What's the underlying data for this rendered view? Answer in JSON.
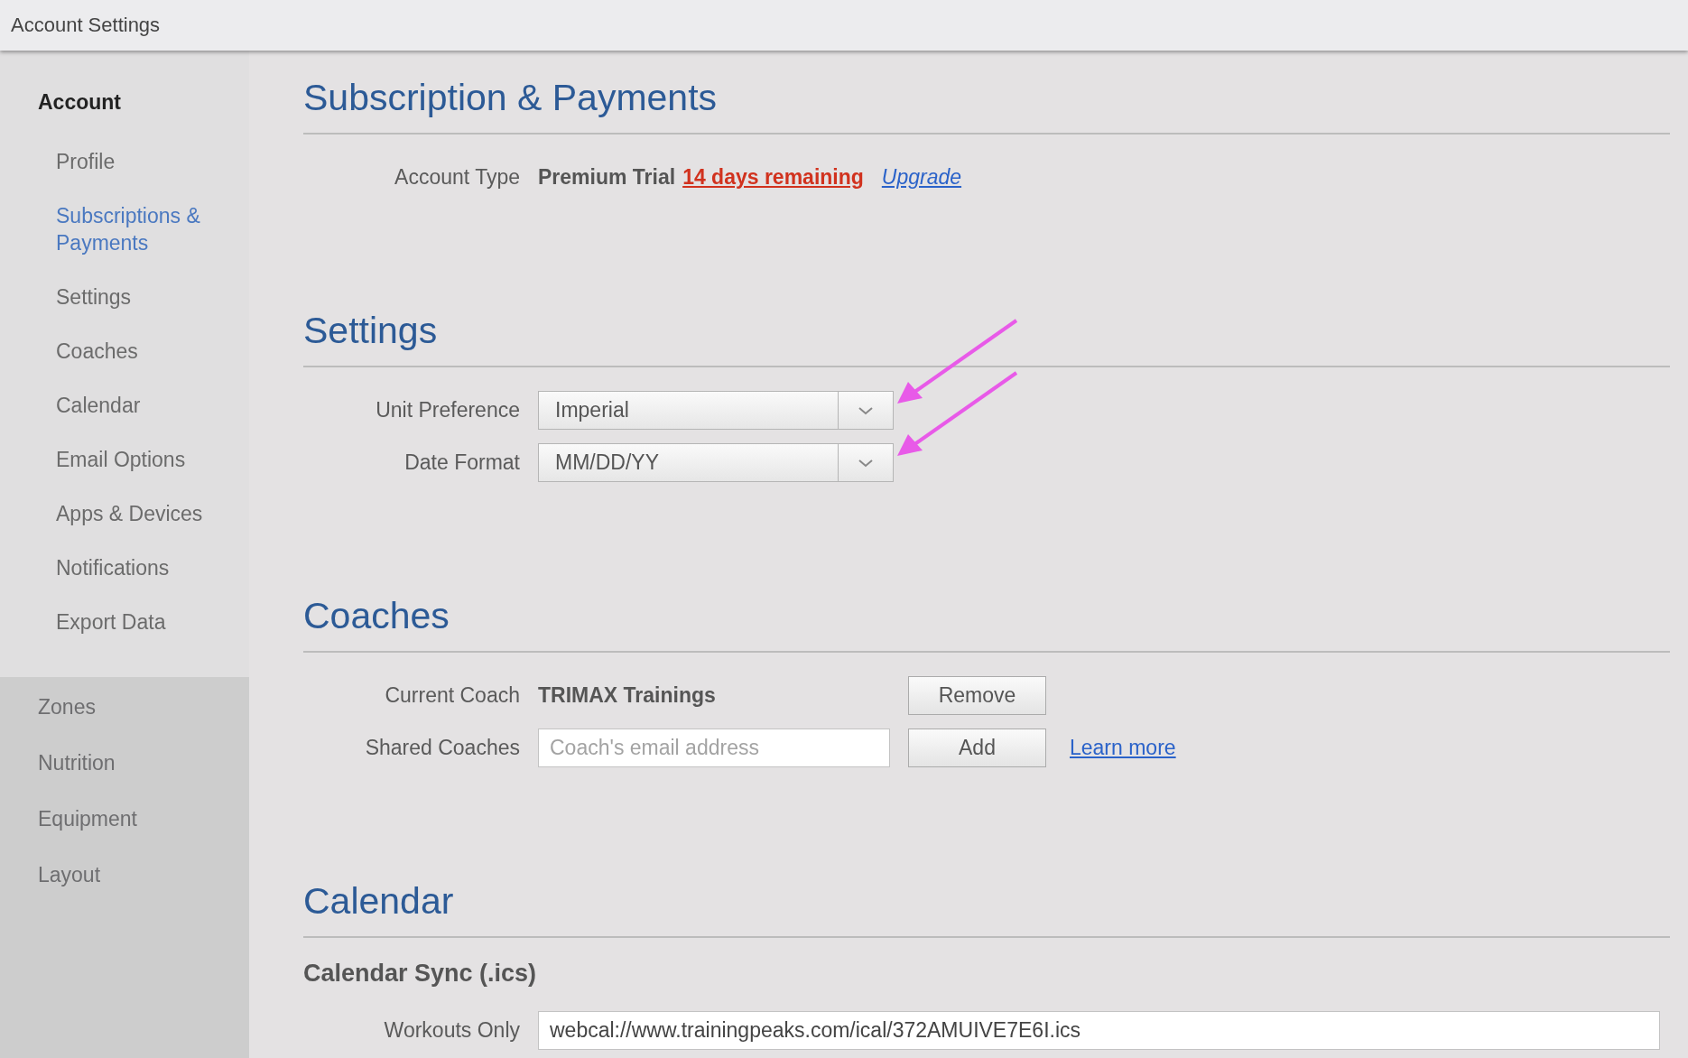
{
  "window": {
    "title": "Account Settings"
  },
  "sidebar": {
    "header": "Account",
    "items": [
      {
        "label": "Profile",
        "selected": false
      },
      {
        "label": "Subscriptions & Payments",
        "selected": true
      },
      {
        "label": "Settings",
        "selected": false
      },
      {
        "label": "Coaches",
        "selected": false
      },
      {
        "label": "Calendar",
        "selected": false
      },
      {
        "label": "Email Options",
        "selected": false
      },
      {
        "label": "Apps & Devices",
        "selected": false
      },
      {
        "label": "Notifications",
        "selected": false
      },
      {
        "label": "Export Data",
        "selected": false
      }
    ],
    "other_items": [
      {
        "label": "Zones"
      },
      {
        "label": "Nutrition"
      },
      {
        "label": "Equipment"
      },
      {
        "label": "Layout"
      }
    ]
  },
  "subscription": {
    "title": "Subscription & Payments",
    "label": "Account Type",
    "plan": "Premium Trial",
    "remaining": "14 days remaining",
    "upgrade_link": "Upgrade"
  },
  "settings": {
    "title": "Settings",
    "rows": [
      {
        "label": "Unit Preference",
        "value": "Imperial",
        "pointer_arrow": true
      },
      {
        "label": "Date Format",
        "value": "MM/DD/YY",
        "pointer_arrow": true
      }
    ]
  },
  "coaches": {
    "title": "Coaches",
    "current_label": "Current Coach",
    "current_coach": "TRIMAX Trainings",
    "remove_button": "Remove",
    "shared_label": "Shared Coaches",
    "email_placeholder": "Coach's email address",
    "add_button": "Add",
    "learn_more_link": "Learn more"
  },
  "calendar": {
    "title": "Calendar",
    "subtitle": "Calendar Sync (.ics)",
    "rows": [
      {
        "label": "Workouts Only",
        "value": "webcal://www.trainingpeaks.com/ical/372AMUIVE7E6I.ics"
      }
    ]
  }
}
